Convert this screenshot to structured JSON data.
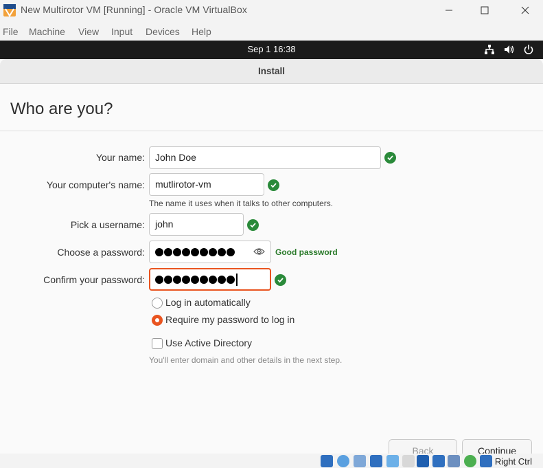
{
  "window": {
    "title": "New Multirotor VM [Running] - Oracle VM VirtualBox"
  },
  "menubar": [
    "File",
    "Machine",
    "View",
    "Input",
    "Devices",
    "Help"
  ],
  "guest_topbar": {
    "clock": "Sep 1  16:38"
  },
  "installer": {
    "title": "Install",
    "heading": "Who are you?",
    "name": {
      "label": "Your name:",
      "value": "John Doe"
    },
    "computer": {
      "label": "Your computer's name:",
      "value": "mutlirotor-vm",
      "hint": "The name it uses when it talks to other computers."
    },
    "username": {
      "label": "Pick a username:",
      "value": "john"
    },
    "password": {
      "label": "Choose a password:",
      "length": 9,
      "strength": "Good password"
    },
    "confirm": {
      "label": "Confirm your password:",
      "length": 9
    },
    "login_options": [
      {
        "label": "Log in automatically",
        "selected": false
      },
      {
        "label": "Require my password to log in",
        "selected": true
      }
    ],
    "active_directory": {
      "label": "Use Active Directory",
      "checked": false,
      "hint": "You'll enter domain and other details in the next step."
    },
    "buttons": {
      "back": "Back",
      "continue": "Continue"
    }
  },
  "statusbar": {
    "host_key": "Right Ctrl"
  },
  "colors": {
    "accent": "#e95420",
    "valid": "#2a8a3a"
  }
}
